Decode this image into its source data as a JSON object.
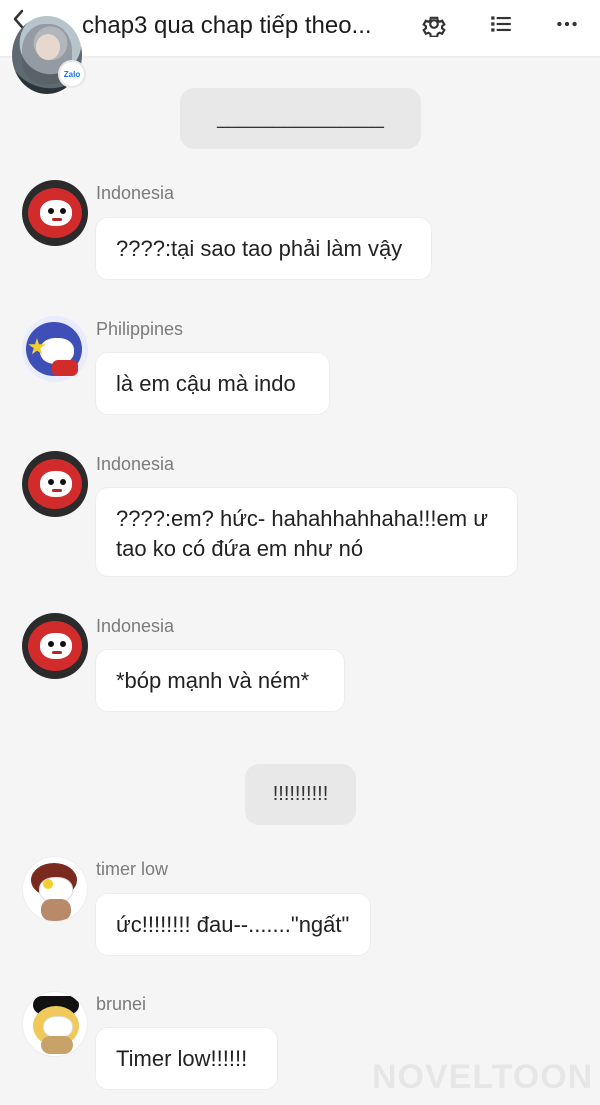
{
  "header": {
    "title": "chap3 qua chap tiếp theo...",
    "badge_text": "Zalo",
    "icons": {
      "back": "chevron-left-icon",
      "settings": "gear-icon",
      "list": "list-icon",
      "more": "more-icon"
    }
  },
  "system_messages": [
    {
      "text": "_______________"
    },
    {
      "text": "!!!!!!!!!!"
    }
  ],
  "messages": [
    {
      "sender": "Indonesia",
      "text": "????:tại sao tao phải làm vậy"
    },
    {
      "sender": "Philippines",
      "text": "là em cậu mà indo"
    },
    {
      "sender": "Indonesia",
      "text": "????:em? hức- hahahhahhaha!!!em ư\ntao ko có đứa em như nó"
    },
    {
      "sender": "Indonesia",
      "text": "*bóp mạnh và ném*"
    },
    {
      "sender": "timer low",
      "text": "ức!!!!!!!! đau--.......\"ngất\""
    },
    {
      "sender": "brunei",
      "text": "Timer low!!!!!!"
    }
  ],
  "watermark": "NOVELTOON"
}
